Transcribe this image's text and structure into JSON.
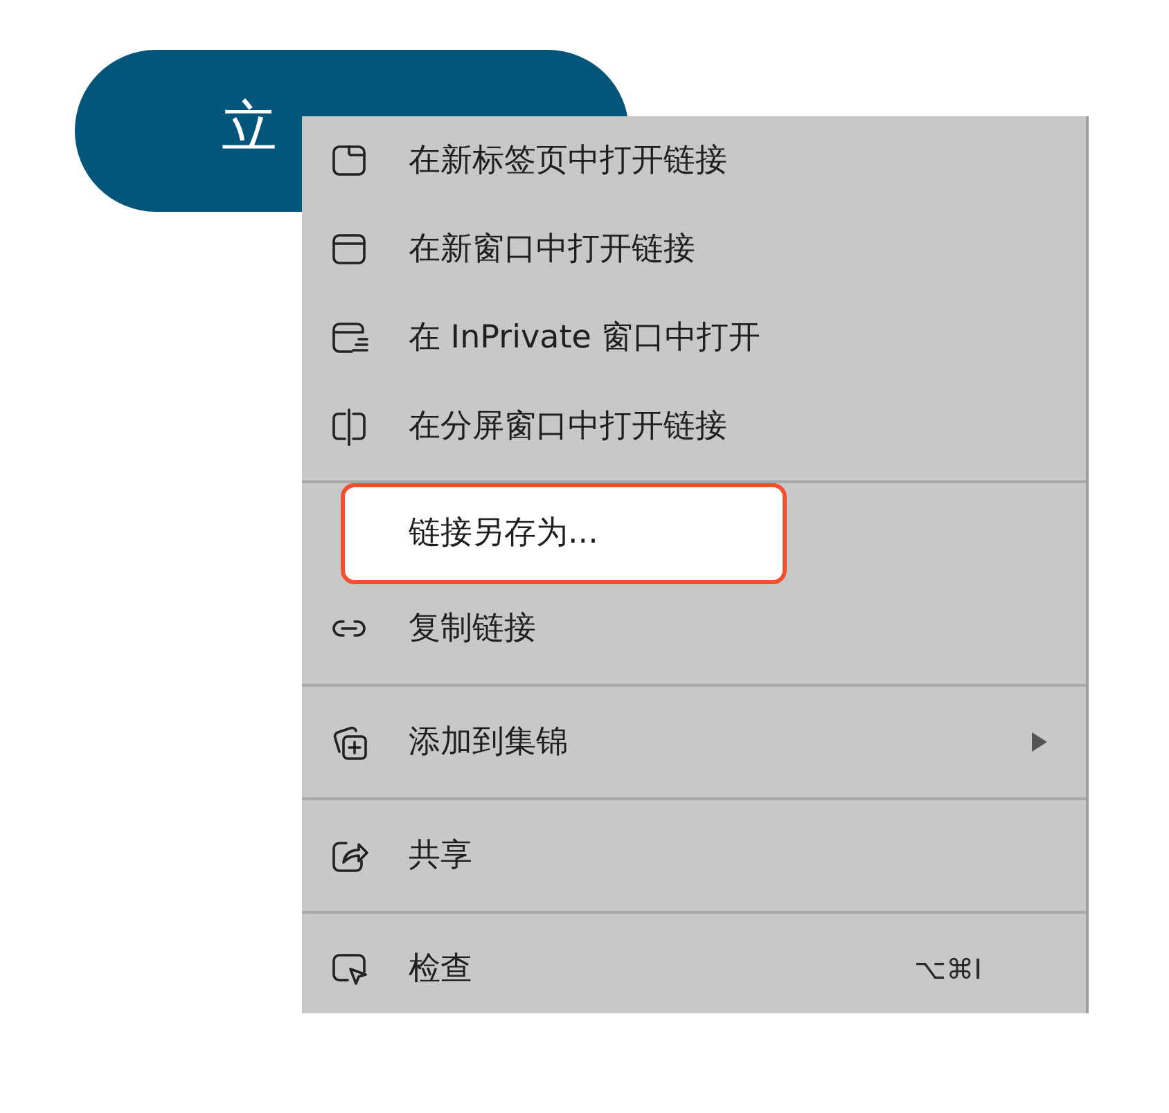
{
  "download_button": {
    "label": "立"
  },
  "context_menu": {
    "sections": [
      {
        "items": [
          {
            "label": "在新标签页中打开链接",
            "highlighted": false
          },
          {
            "label": "在新窗口中打开链接",
            "highlighted": false
          },
          {
            "label": "在 InPrivate 窗口中打开",
            "highlighted": false
          },
          {
            "label": "在分屏窗口中打开链接",
            "highlighted": false
          }
        ]
      },
      {
        "items": [
          {
            "label": "链接另存为...",
            "highlighted": true
          },
          {
            "label": "复制链接",
            "highlighted": false
          }
        ]
      },
      {
        "items": [
          {
            "label": "添加到集锦",
            "highlighted": false,
            "submenu": true
          }
        ]
      },
      {
        "items": [
          {
            "label": "共享",
            "highlighted": false
          }
        ]
      },
      {
        "items": [
          {
            "label": "检查",
            "highlighted": false,
            "shortcut": "⌥⌘I"
          }
        ]
      }
    ]
  }
}
